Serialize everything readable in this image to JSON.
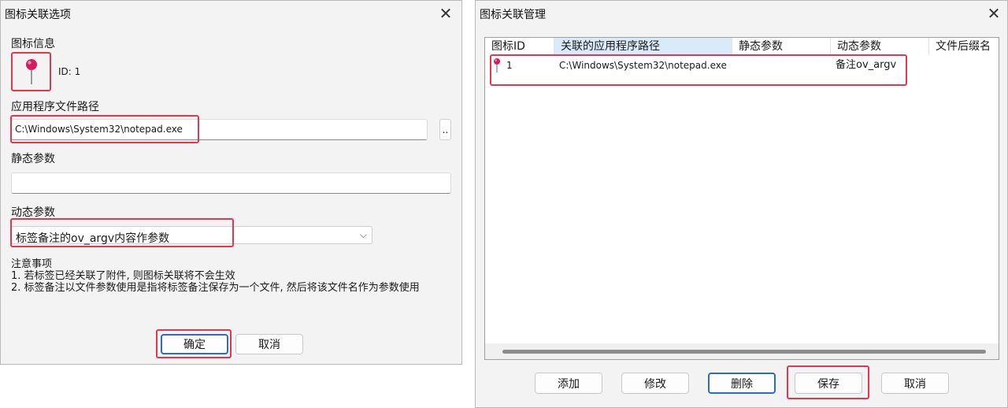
{
  "options_dialog": {
    "title": "图标关联选项",
    "icon_info_label": "图标信息",
    "id_text": "ID: 1",
    "app_path_label": "应用程序文件路径",
    "app_path_value": "C:\\Windows\\System32\\notepad.exe",
    "browse_label": "..",
    "static_params_label": "静态参数",
    "static_params_value": "",
    "dynamic_params_label": "动态参数",
    "dynamic_params_selected": "标签备注的ov_argv内容作参数",
    "notes_title": "注意事项",
    "notes_line1": "1. 若标签已经关联了附件, 则图标关联将不会生效",
    "notes_line2": "2. 标签备注以文件参数使用是指将标签备注保存为一个文件, 然后将该文件名作为参数使用",
    "ok_label": "确定",
    "cancel_label": "取消"
  },
  "manage_dialog": {
    "title": "图标关联管理",
    "columns": [
      "图标ID",
      "关联的应用程序路径",
      "静态参数",
      "动态参数",
      "文件后缀名"
    ],
    "rows": [
      {
        "id": "1",
        "path": "C:\\Windows\\System32\\notepad.exe",
        "static": "",
        "dynamic": "备注ov_argv",
        "suffix": ""
      }
    ],
    "buttons": {
      "add": "添加",
      "edit": "修改",
      "delete": "删除",
      "save": "保存",
      "cancel": "取消"
    }
  },
  "icons": {
    "pin": "pushpin-icon",
    "close": "close-icon",
    "chevron": "chevron-down-icon"
  },
  "colors": {
    "highlight": "#e0394f",
    "pin_head": "#d81b60",
    "accent": "#2b6cc4"
  }
}
